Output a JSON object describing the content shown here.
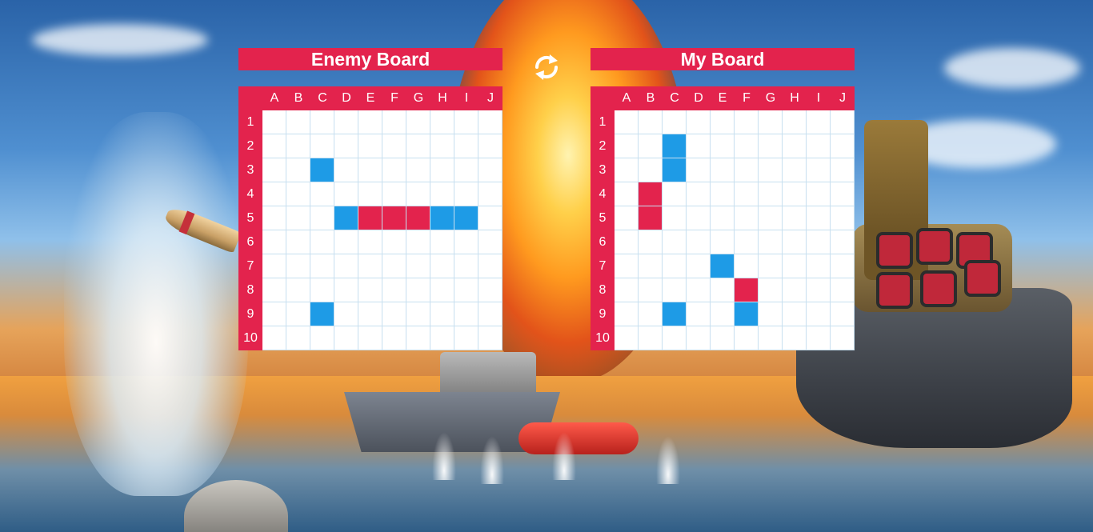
{
  "boards": {
    "enemy": {
      "title": "Enemy Board"
    },
    "mine": {
      "title": "My Board"
    }
  },
  "columns": [
    "A",
    "B",
    "C",
    "D",
    "E",
    "F",
    "G",
    "H",
    "I",
    "J"
  ],
  "rows": [
    "1",
    "2",
    "3",
    "4",
    "5",
    "6",
    "7",
    "8",
    "9",
    "10"
  ],
  "cell_states": {
    "enemy": [
      [
        "",
        "",
        "",
        "",
        "",
        "",
        "",
        "",
        "",
        ""
      ],
      [
        "",
        "",
        "",
        "",
        "",
        "",
        "",
        "",
        "",
        ""
      ],
      [
        "",
        "",
        "miss",
        "",
        "",
        "",
        "",
        "",
        "",
        ""
      ],
      [
        "",
        "",
        "",
        "",
        "",
        "",
        "",
        "",
        "",
        ""
      ],
      [
        "",
        "",
        "",
        "miss",
        "hit",
        "hit",
        "hit",
        "miss",
        "miss",
        ""
      ],
      [
        "",
        "",
        "",
        "",
        "",
        "",
        "",
        "",
        "",
        ""
      ],
      [
        "",
        "",
        "",
        "",
        "",
        "",
        "",
        "",
        "",
        ""
      ],
      [
        "",
        "",
        "",
        "",
        "",
        "",
        "",
        "",
        "",
        ""
      ],
      [
        "",
        "",
        "miss",
        "",
        "",
        "",
        "",
        "",
        "",
        ""
      ],
      [
        "",
        "",
        "",
        "",
        "",
        "",
        "",
        "",
        "",
        ""
      ]
    ],
    "mine": [
      [
        "",
        "",
        "",
        "",
        "",
        "",
        "",
        "",
        "",
        ""
      ],
      [
        "",
        "",
        "miss",
        "",
        "",
        "",
        "",
        "",
        "",
        ""
      ],
      [
        "",
        "",
        "miss",
        "",
        "",
        "",
        "",
        "",
        "",
        ""
      ],
      [
        "",
        "hit",
        "",
        "",
        "",
        "",
        "",
        "",
        "",
        ""
      ],
      [
        "",
        "hit",
        "",
        "",
        "",
        "",
        "",
        "",
        "",
        ""
      ],
      [
        "",
        "",
        "",
        "",
        "",
        "",
        "",
        "",
        "",
        ""
      ],
      [
        "",
        "",
        "",
        "",
        "miss",
        "",
        "",
        "",
        "",
        ""
      ],
      [
        "",
        "",
        "",
        "",
        "",
        "hit",
        "",
        "",
        "",
        ""
      ],
      [
        "",
        "",
        "miss",
        "",
        "",
        "miss",
        "",
        "",
        "",
        ""
      ],
      [
        "",
        "",
        "",
        "",
        "",
        "",
        "",
        "",
        "",
        ""
      ]
    ]
  },
  "colors": {
    "accent": "#e3234d",
    "hit": "#e3234d",
    "miss": "#1e9be6",
    "grid_line": "#c7dff0"
  },
  "icons": {
    "swap": "swap-boards-icon"
  }
}
